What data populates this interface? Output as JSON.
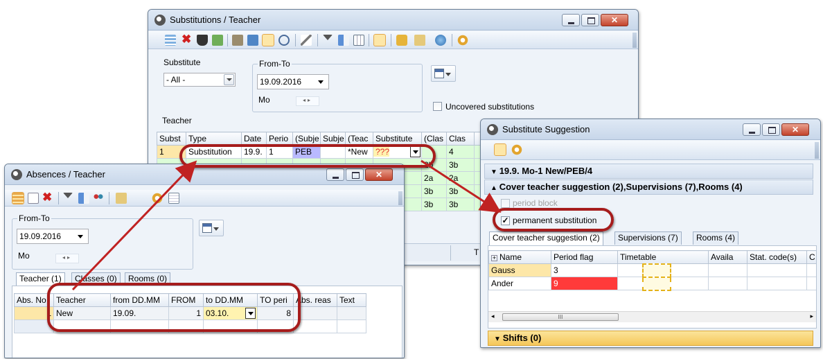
{
  "substitutions_window": {
    "title": "Substitutions / Teacher",
    "substitute_label": "Substitute",
    "substitute_value": "- All -",
    "from_to_label": "From-To",
    "date_value": "19.09.2016",
    "day_label": "Mo",
    "uncovered_label": "Uncovered substitutions",
    "teacher_label": "Teacher",
    "columns": [
      "Subst",
      "Type",
      "Date",
      "Perio",
      "(Subje",
      "Subje",
      "(Teac",
      "Substitute",
      "(Clas",
      "Clas"
    ],
    "rows": [
      [
        "1",
        "Substitution",
        "19.9.",
        "1",
        "PEB",
        "",
        "*New",
        "???",
        "",
        "4"
      ],
      [
        "",
        "",
        "",
        "",
        "",
        "",
        "",
        "",
        "2b",
        "3b"
      ],
      [
        "",
        "",
        "",
        "",
        "",
        "",
        "",
        "",
        "2a",
        "2a"
      ],
      [
        "",
        "",
        "",
        "",
        "",
        "",
        "",
        "",
        "3b",
        "3b"
      ],
      [
        "",
        "",
        "",
        "",
        "",
        "",
        "",
        "",
        "3b",
        "3b"
      ]
    ],
    "status_letter": "T"
  },
  "absences_window": {
    "title": "Absences / Teacher",
    "from_to_label": "From-To",
    "date_value": "19.09.2016",
    "day_label": "Mo",
    "tabs": [
      "Teacher (1)",
      "Classes (0)",
      "Rooms (0)"
    ],
    "columns": [
      "Abs. No",
      "Teacher",
      "from DD.MM",
      "FROM",
      "to DD.MM",
      "TO peri",
      "Abs. reas",
      "Text"
    ],
    "row": [
      "1",
      "New",
      "19.09.",
      "1",
      "03.10.",
      "8",
      "",
      ""
    ]
  },
  "suggestion_window": {
    "title": "Substitute Suggestion",
    "section_1": "19.9. Mo-1 New/PEB/4",
    "section_2": "Cover teacher suggestion (2),Supervisions (7),Rooms (4)",
    "period_block_label": "period block",
    "permanent_label": "permanent substitution",
    "permanent_checked": "✓",
    "tabs": [
      "Cover teacher suggestion (2)",
      "Supervisions (7)",
      "Rooms (4)"
    ],
    "columns": [
      "Name",
      "Period flag",
      "Timetable",
      "Availa",
      "Stat. code(s)",
      "C"
    ],
    "expand_glyph": "+",
    "rows": [
      {
        "name": "Gauss",
        "flag": "3"
      },
      {
        "name": "Ander",
        "flag": "9"
      }
    ],
    "scroll_mark": "III",
    "shifts_label": "Shifts (0)"
  },
  "colors": {
    "highlight_ring": "#a61c1c",
    "arrow": "#c02222",
    "selected_row": "#fde7a8",
    "red_cell": "#ff3a3a",
    "green_cell": "#dcfcd8",
    "blue_cell": "#b9b9ff"
  }
}
